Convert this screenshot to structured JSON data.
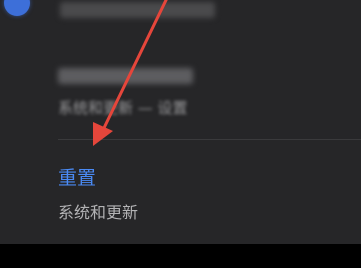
{
  "settings": {
    "previous_item": {
      "subtitle": "系统和更新 — 设置"
    },
    "reset_item": {
      "title": "重置",
      "subtitle": "系统和更新"
    }
  },
  "annotation": {
    "arrow_color": "#e5463b"
  },
  "colors": {
    "accent": "#4a8af4",
    "background": "#262628"
  }
}
